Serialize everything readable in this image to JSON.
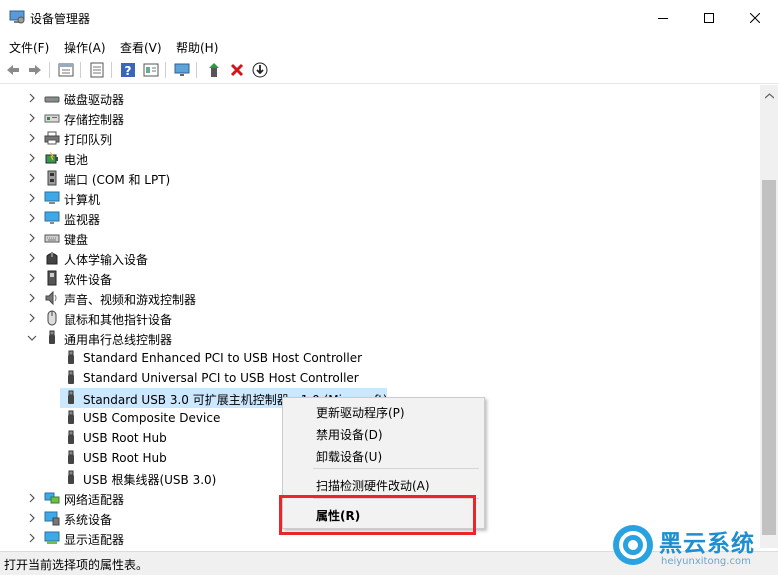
{
  "window": {
    "title": "设备管理器"
  },
  "menu": [
    "文件(F)",
    "操作(A)",
    "查看(V)",
    "帮助(H)"
  ],
  "toolbar": [
    "back-icon",
    "forward-icon",
    "properties-icon",
    "update-icon",
    "help-icon",
    "view-icon",
    "monitor-icon",
    "enable-device-icon",
    "uninstall-icon",
    "download-icon"
  ],
  "tree": {
    "categories": [
      {
        "label": "磁盘驱动器",
        "icon": "disk-icon",
        "expanded": false
      },
      {
        "label": "存储控制器",
        "icon": "storage-icon",
        "expanded": false
      },
      {
        "label": "打印队列",
        "icon": "printer-icon",
        "expanded": false
      },
      {
        "label": "电池",
        "icon": "battery-icon",
        "expanded": false
      },
      {
        "label": "端口 (COM 和 LPT)",
        "icon": "port-icon",
        "expanded": false
      },
      {
        "label": "计算机",
        "icon": "computer-icon",
        "expanded": false
      },
      {
        "label": "监视器",
        "icon": "monitor-icon",
        "expanded": false
      },
      {
        "label": "键盘",
        "icon": "keyboard-icon",
        "expanded": false
      },
      {
        "label": "人体学输入设备",
        "icon": "hid-icon",
        "expanded": false
      },
      {
        "label": "软件设备",
        "icon": "software-device-icon",
        "expanded": false
      },
      {
        "label": "声音、视频和游戏控制器",
        "icon": "speaker-icon",
        "expanded": false
      },
      {
        "label": "鼠标和其他指针设备",
        "icon": "mouse-icon",
        "expanded": false
      },
      {
        "label": "通用串行总线控制器",
        "icon": "usb-icon",
        "expanded": true
      }
    ],
    "usb_children": [
      "Standard Enhanced PCI to USB Host Controller",
      "Standard Universal PCI to USB Host Controller",
      "Standard USB 3.0 可扩展主机控制器 - 1.0 (Microsoft)",
      "USB Composite Device",
      "USB Root Hub",
      "USB Root Hub",
      "USB 根集线器(USB 3.0)"
    ],
    "after": [
      {
        "label": "网络适配器",
        "icon": "network-icon"
      },
      {
        "label": "系统设备",
        "icon": "system-icon"
      },
      {
        "label": "显示适配器",
        "icon": "display-icon"
      }
    ]
  },
  "context_menu": {
    "update": "更新驱动程序(P)",
    "disable": "禁用设备(D)",
    "uninstall": "卸载设备(U)",
    "scan": "扫描检测硬件改动(A)",
    "properties": "属性(R)"
  },
  "status": "打开当前选择项的属性表。",
  "watermark": {
    "brand": "黑云系统",
    "url": "heiyunxitong.com"
  },
  "colors": {
    "selection": "#cce8ff",
    "highlight": "#e8262c",
    "watermark": "#1d8fcf"
  }
}
